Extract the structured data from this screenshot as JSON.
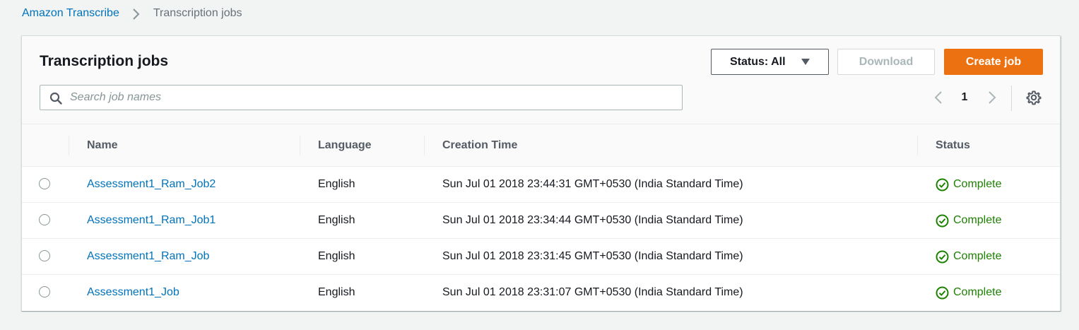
{
  "breadcrumb": {
    "root": "Amazon Transcribe",
    "current": "Transcription jobs"
  },
  "panel": {
    "title": "Transcription jobs"
  },
  "toolbar": {
    "status_filter": "Status: All",
    "download_label": "Download",
    "create_label": "Create job"
  },
  "search": {
    "placeholder": "Search job names",
    "value": ""
  },
  "pagination": {
    "current_page": "1"
  },
  "table": {
    "columns": [
      "Name",
      "Language",
      "Creation Time",
      "Status"
    ],
    "rows": [
      {
        "name": "Assessment1_Ram_Job2",
        "language": "English",
        "created": "Sun Jul 01 2018 23:44:31 GMT+0530 (India Standard Time)",
        "status": "Complete"
      },
      {
        "name": "Assessment1_Ram_Job1",
        "language": "English",
        "created": "Sun Jul 01 2018 23:34:44 GMT+0530 (India Standard Time)",
        "status": "Complete"
      },
      {
        "name": "Assessment1_Ram_Job",
        "language": "English",
        "created": "Sun Jul 01 2018 23:31:45 GMT+0530 (India Standard Time)",
        "status": "Complete"
      },
      {
        "name": "Assessment1_Job",
        "language": "English",
        "created": "Sun Jul 01 2018 23:31:07 GMT+0530 (India Standard Time)",
        "status": "Complete"
      }
    ]
  },
  "icons": {
    "breadcrumb_separator": "chevron-right-icon",
    "status_caret": "caret-down-icon",
    "search": "search-icon",
    "prev_page": "chevron-left-icon",
    "next_page": "chevron-right-icon",
    "settings": "gear-icon",
    "status_complete": "check-circle-icon"
  },
  "colors": {
    "link": "#0073bb",
    "primary_button": "#ec7211",
    "success": "#1d8102",
    "background": "#f2f3f3"
  }
}
